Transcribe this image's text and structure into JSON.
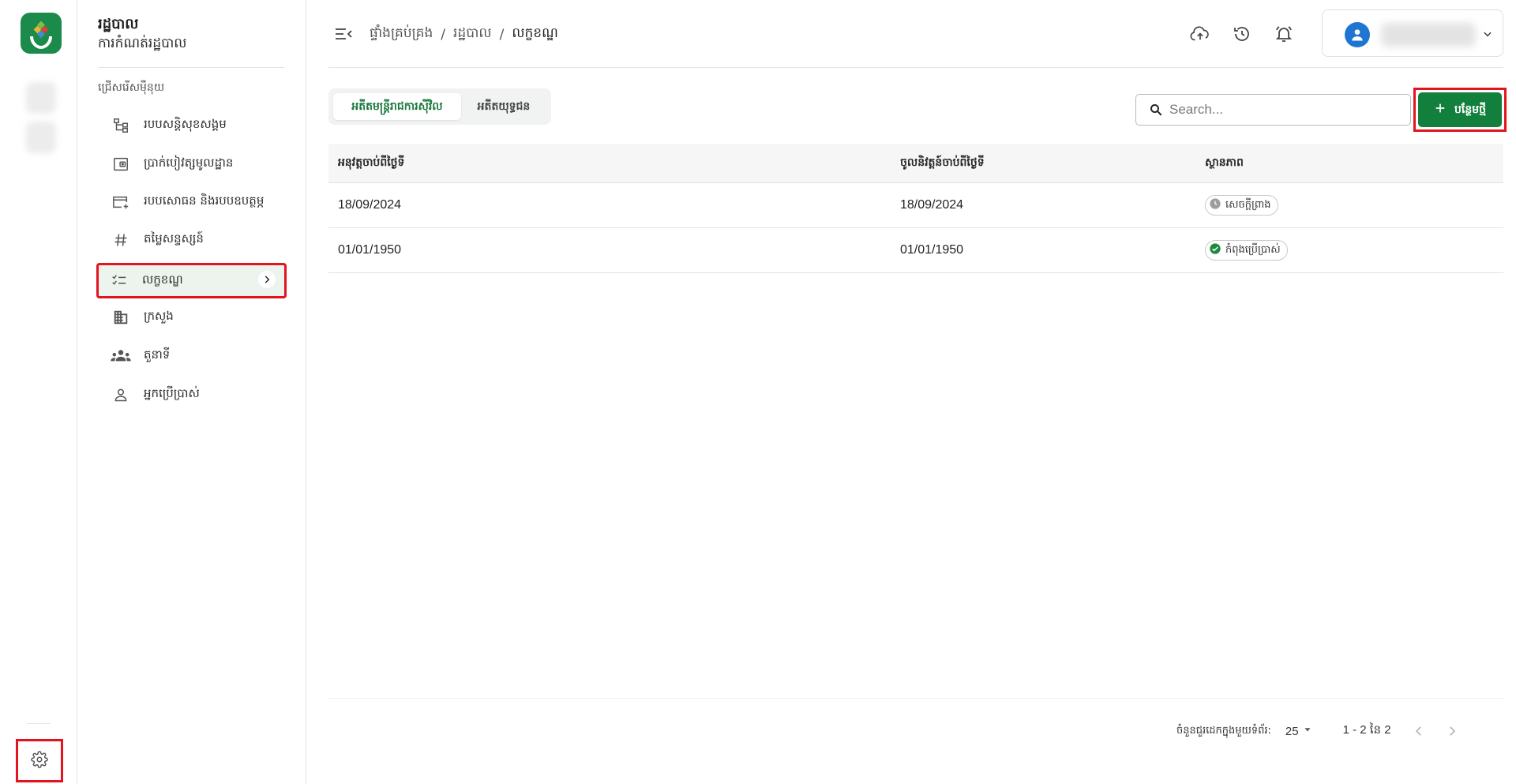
{
  "rail": {
    "logo_icon": "hands-house-logo",
    "settings_icon": "gear-icon"
  },
  "sidebar": {
    "title": "រដ្ឋបាល",
    "subtitle": "ការកំណត់រដ្ឋបាល",
    "section_label": "ជ្រើសរើសម៉ឺនុយ",
    "items": [
      {
        "label": "របបសន្តិសុខសង្គម",
        "icon": "hierarchy-icon"
      },
      {
        "label": "ប្រាក់បៀវត្សមូលដ្ឋាន",
        "icon": "wallet-icon"
      },
      {
        "label": "របបសោធន និងរបបឧបត្ថម្ភ",
        "icon": "card-plus-icon"
      },
      {
        "label": "តម្លៃសន្ទស្សន៍",
        "icon": "hash-icon"
      },
      {
        "label": "លក្ខខណ្ឌ",
        "icon": "checklist-icon",
        "active": true
      },
      {
        "label": "ក្រសួង",
        "icon": "building-icon"
      },
      {
        "label": "តួនាទី",
        "icon": "group-icon"
      },
      {
        "label": "អ្នកប្រើប្រាស់",
        "icon": "person-icon"
      }
    ]
  },
  "topbar": {
    "breadcrumb": [
      "ផ្ទាំងគ្រប់គ្រង",
      "រដ្ឋបាល",
      "លក្ខខណ្ឌ"
    ],
    "separator": "/",
    "icons": [
      "cloud-upload-icon",
      "history-icon",
      "bell-icon"
    ]
  },
  "tabs": [
    {
      "label": "អតីតមន្ត្រីរាជការស៊ីវិល",
      "active": true
    },
    {
      "label": "អតីតយុទ្ធជន",
      "active": false
    }
  ],
  "search": {
    "placeholder": "Search..."
  },
  "add_button": {
    "label": "បន្ថែមថ្មី"
  },
  "table": {
    "headers": [
      "អនុវត្តចាប់ពីថ្ងៃទី",
      "ចូលនិវត្តន៍ចាប់ពីថ្ងៃទី",
      "ស្ថានភាព"
    ],
    "rows": [
      {
        "effective_from": "18/09/2024",
        "retired_from": "18/09/2024",
        "status": "សេចក្តីព្រាង",
        "status_icon": "clock-icon"
      },
      {
        "effective_from": "01/01/1950",
        "retired_from": "01/01/1950",
        "status": "កំពុងប្រើប្រាស់",
        "status_icon": "check-circle-icon"
      }
    ]
  },
  "pagination": {
    "rows_per_page_label": "ចំនួនជួរដេកក្នុងមួយទំព័រ:",
    "rows_per_page": "25",
    "range": "1 - 2 នៃ 2"
  },
  "colors": {
    "primary": "#12803c",
    "highlight_box": "#e3141e",
    "avatar": "#1e76d2"
  }
}
